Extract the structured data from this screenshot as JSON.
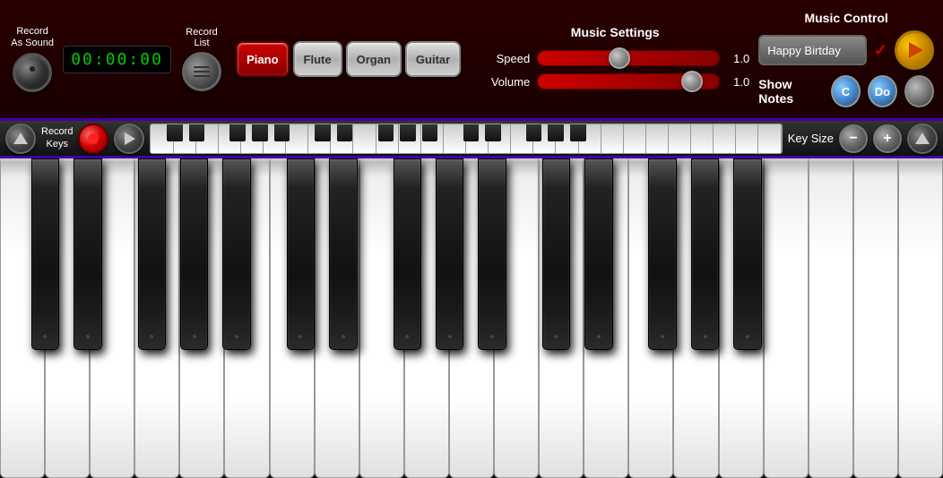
{
  "header": {
    "record_as_sound": "Record\nAs Sound",
    "record_as_sound_line1": "Record",
    "record_as_sound_line2": "As Sound",
    "timer": "00:00:00",
    "record_list": "Record\nList",
    "record_list_line1": "Record",
    "record_list_line2": "List"
  },
  "instruments": {
    "buttons": [
      "Piano",
      "Flute",
      "Organ",
      "Guitar"
    ],
    "active": "Piano"
  },
  "music_settings": {
    "title": "Music Settings",
    "speed_label": "Speed",
    "speed_value": "1.0",
    "speed_position": 0.45,
    "volume_label": "Volume",
    "volume_value": "1.0",
    "volume_position": 0.85
  },
  "music_control": {
    "title": "Music Control",
    "song_name": "Happy Birtday",
    "play_label": "Play",
    "show_notes_label": "Show Notes",
    "note_c": "C",
    "note_do": "Do"
  },
  "control_bar": {
    "record_keys_label": "Record\nKeys",
    "record_keys_line1": "Record",
    "record_keys_line2": "Keys",
    "key_size_label": "Key Size"
  },
  "colors": {
    "accent": "#cc0000",
    "bg_dark": "#1a0000",
    "bg_bar": "#2a0000",
    "purple_border": "#4400aa"
  }
}
